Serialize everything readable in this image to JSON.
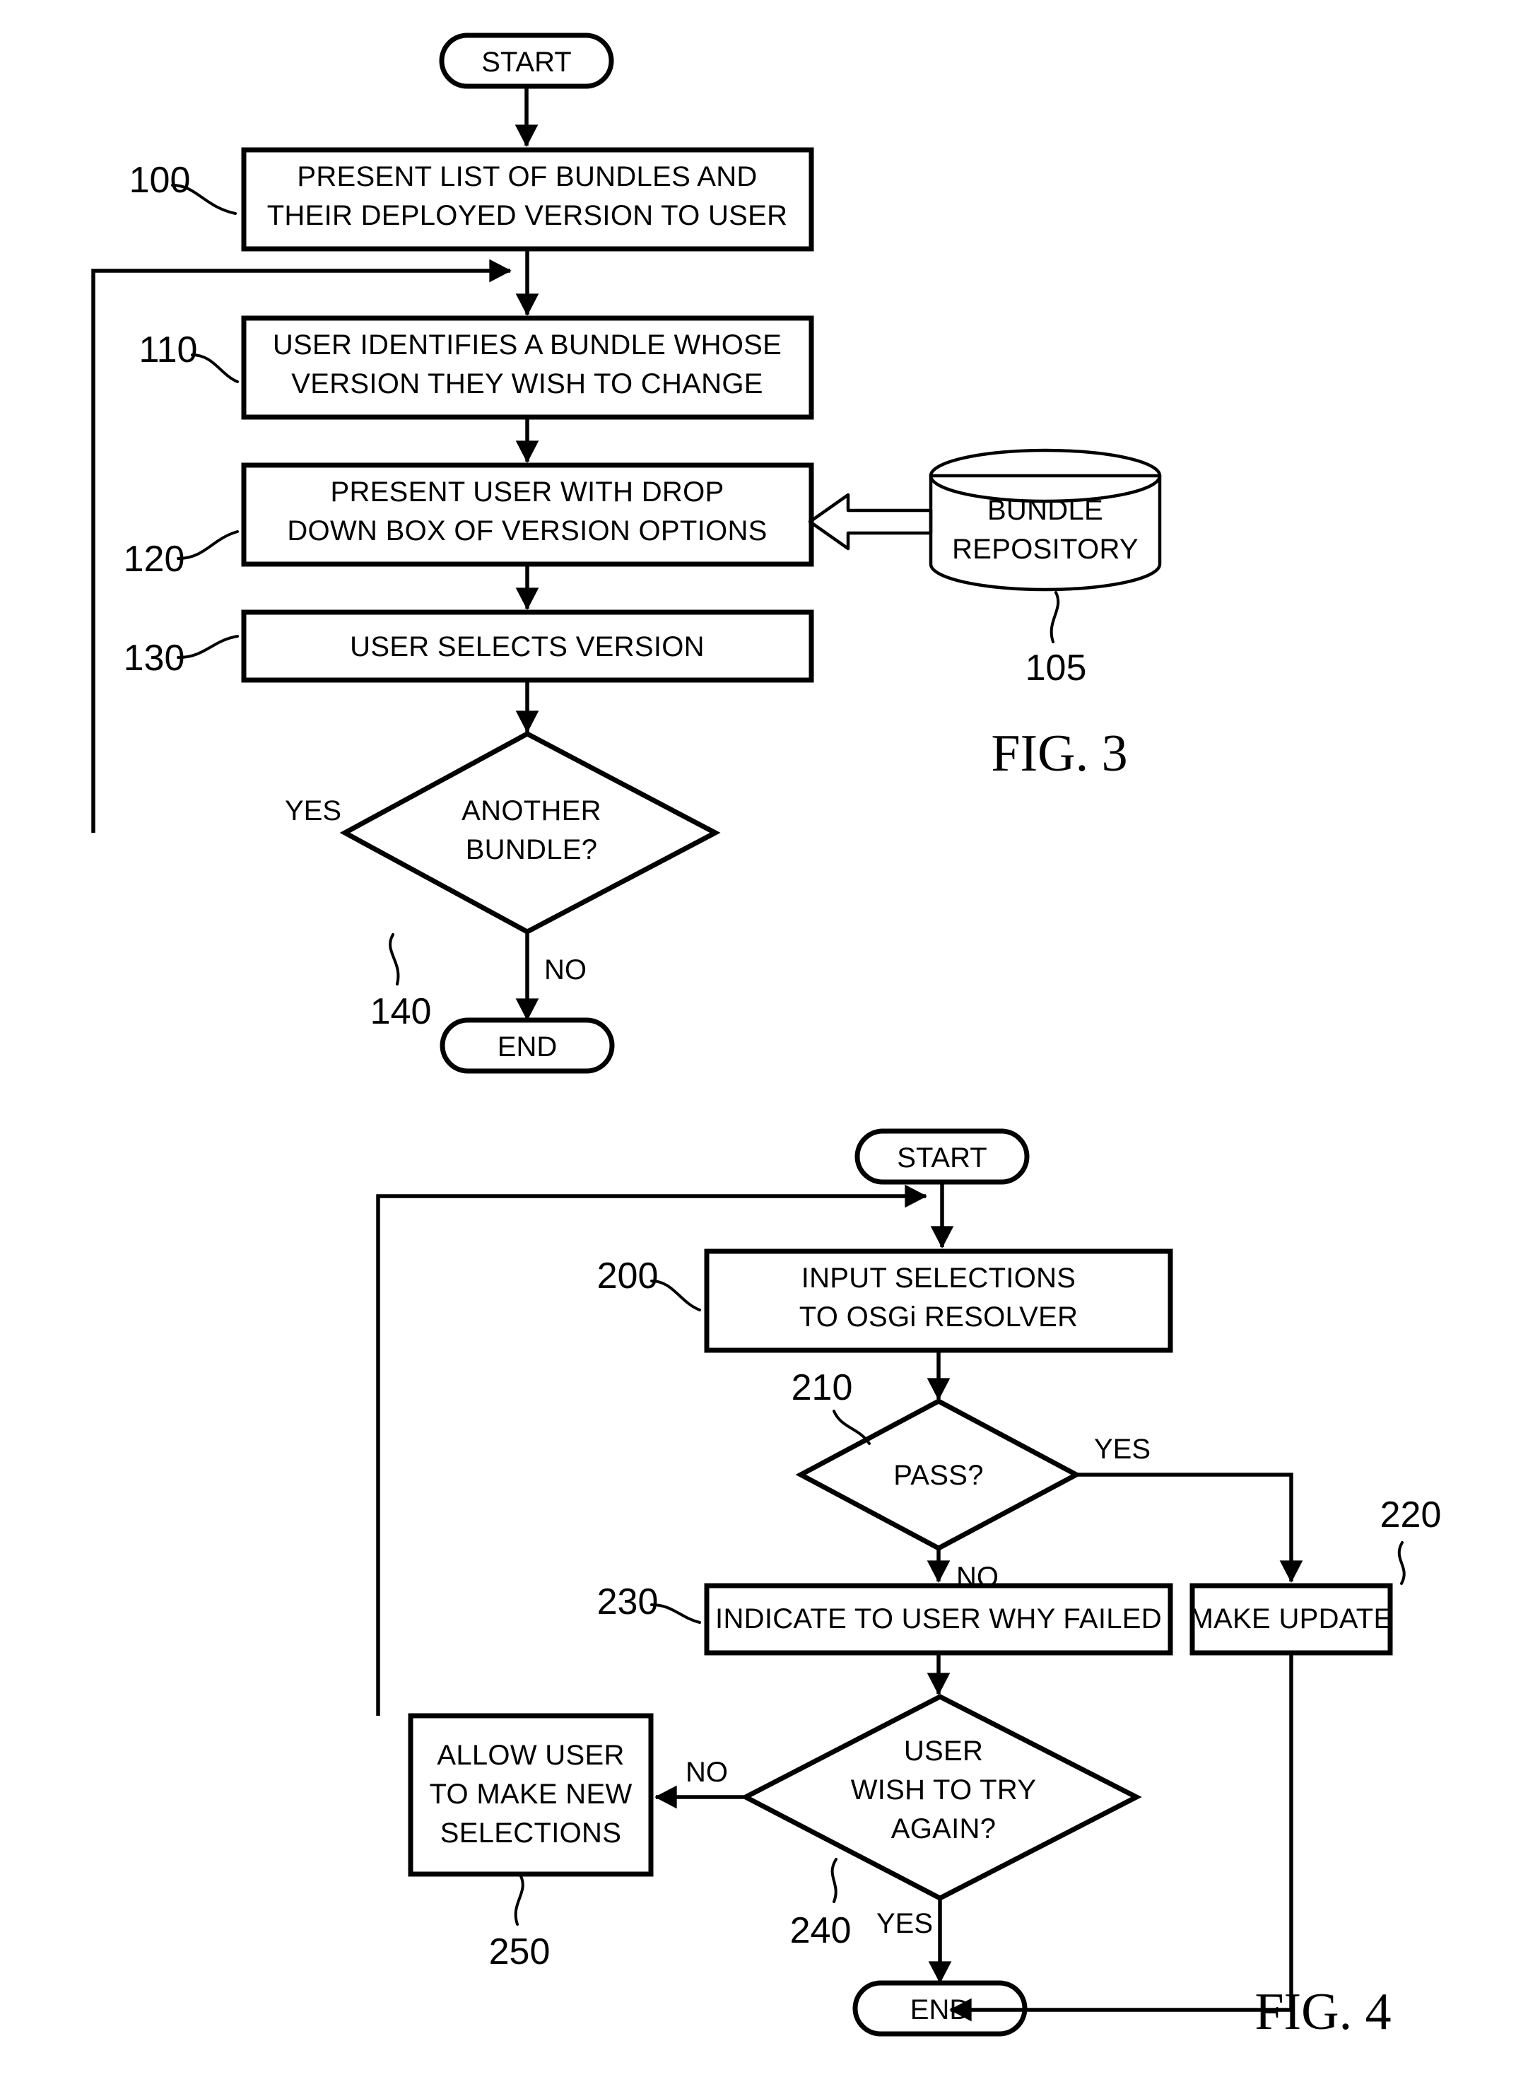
{
  "document": {
    "type": "patent-drawing-sheet",
    "figures": [
      {
        "id": "fig3",
        "caption": "FIG. 3",
        "nodes": {
          "start": "START",
          "step100": {
            "ref": "100",
            "line1": "PRESENT LIST OF BUNDLES AND",
            "line2": "THEIR DEPLOYED VERSION TO USER"
          },
          "step110": {
            "ref": "110",
            "line1": "USER IDENTIFIES A BUNDLE WHOSE",
            "line2": "VERSION THEY WISH TO CHANGE"
          },
          "step120": {
            "ref": "120",
            "line1": "PRESENT USER WITH DROP",
            "line2": "DOWN BOX OF VERSION OPTIONS"
          },
          "step130": {
            "ref": "130",
            "line1": "USER SELECTS VERSION"
          },
          "decision140": {
            "ref": "140",
            "line1": "ANOTHER",
            "line2": "BUNDLE?"
          },
          "repository105": {
            "ref": "105",
            "line1": "BUNDLE",
            "line2": "REPOSITORY"
          },
          "end": "END"
        },
        "edge_labels": {
          "yes": "YES",
          "no": "NO"
        }
      },
      {
        "id": "fig4",
        "caption": "FIG. 4",
        "nodes": {
          "start": "START",
          "step200": {
            "ref": "200",
            "line1": "INPUT SELECTIONS",
            "line2": "TO OSGi RESOLVER"
          },
          "decision210": {
            "ref": "210",
            "line1": "PASS?"
          },
          "step220": {
            "ref": "220",
            "line1": "MAKE UPDATE"
          },
          "step230": {
            "ref": "230",
            "line1": "INDICATE TO USER WHY FAILED"
          },
          "decision240": {
            "ref": "240",
            "line1": "USER",
            "line2": "WISH TO TRY",
            "line3": "AGAIN?"
          },
          "step250": {
            "ref": "250",
            "line1": "ALLOW USER",
            "line2": "TO MAKE NEW",
            "line3": "SELECTIONS"
          },
          "end": "END"
        },
        "edge_labels": {
          "yes_pass": "YES",
          "no_pass": "NO",
          "no_again": "NO",
          "yes_again": "YES"
        }
      }
    ],
    "colors": {
      "ink": "#000000",
      "paper": "#ffffff"
    }
  }
}
